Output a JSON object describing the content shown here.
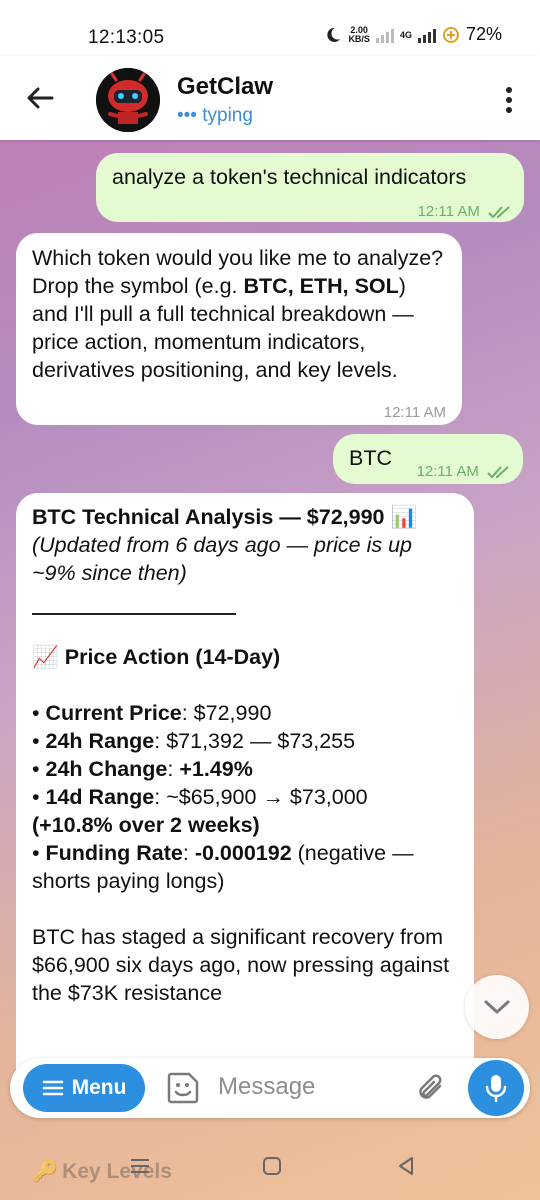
{
  "status": {
    "time": "12:13:05",
    "speed_value": "2.00",
    "speed_unit": "KB/S",
    "network": "4G",
    "battery": "72%"
  },
  "header": {
    "name": "GetClaw",
    "status": "••• typing"
  },
  "messages": {
    "m1": {
      "text": "analyze a token's technical indicators",
      "time": "12:11 AM"
    },
    "m2": {
      "part1": "Which token would you like me to analyze? Drop the symbol (e.g. ",
      "bold": "BTC, ETH, SOL",
      "part2": ") and I'll pull a full technical breakdown — price action, momentum indicators, derivatives positioning, and key levels.",
      "time": "12:11 AM"
    },
    "m3": {
      "text": "BTC",
      "time": "12:11 AM"
    },
    "m4": {
      "title": "BTC Technical Analysis — $72,990 📊",
      "subtitle": "(Updated from 6 days ago — price is up ~9% since then)",
      "section_title": "📈 Price Action (14-Day)",
      "b1_label": "Current Price",
      "b1_value": ": $72,990",
      "b2_label": "24h Range",
      "b2_value": ": $71,392 — $73,255",
      "b3_label": "24h Change",
      "b3_sep": ": ",
      "b3_value": "+1.49%",
      "b4_label": "14d Range",
      "b4_value": ": ~$65,900 → $73,000",
      "b4_note": "(+10.8% over 2 weeks)",
      "b5_label": "Funding Rate",
      "b5_sep": ": ",
      "b5_value": "-0.000192",
      "b5_note": " (negative — shorts paying longs)",
      "para": "BTC has staged a significant recovery from $66,900 six days ago, now pressing against the $73K resistance"
    }
  },
  "input": {
    "menu_label": "Menu",
    "placeholder": "Message"
  },
  "underlay": {
    "icon": "🔑",
    "text": "Key Levels"
  },
  "colors": {
    "accent": "#2d8fe0",
    "outgoing_bubble": "#e4fbd2",
    "incoming_bubble": "#ffffff",
    "read_ticks": "#6bb06a"
  },
  "icons": [
    "back-arrow-icon",
    "more-vert-icon",
    "sticker-icon",
    "paperclip-icon",
    "mic-icon",
    "chevron-down-icon",
    "menu-lines-icon"
  ]
}
